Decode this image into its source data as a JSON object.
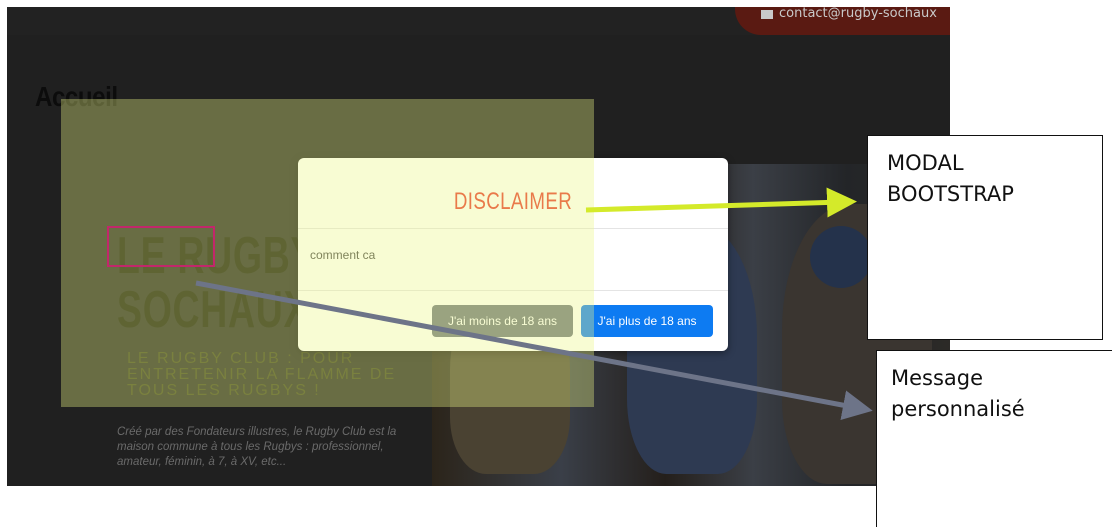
{
  "header": {
    "contact_email": "contact@rugby-sochaux"
  },
  "page": {
    "title": "Accueil"
  },
  "hero": {
    "title_line1": "LE RUGBY",
    "title_line2": "SOCHAUX",
    "subtitle": "LE RUGBY CLUB : POUR ENTRETENIR LA FLAMME DE TOUS LES RUGBYS !",
    "text": "Créé par des Fondateurs illustres, le Rugby Club est la maison commune à tous les Rugbys : professionnel, amateur, féminin, à 7, à XV, etc..."
  },
  "modal": {
    "title": "DISCLAIMER",
    "body": "comment ca",
    "button_minor": "J'ai moins de 18 ans",
    "button_major": "J'ai plus de 18 ans"
  },
  "annotations": {
    "callout_modal_line1": "MODAL",
    "callout_modal_line2": "BOOTSTRAP",
    "callout_message_line1": "Message",
    "callout_message_line2": "personnalisé"
  },
  "colors": {
    "modal_title": "#e8352a",
    "button_major": "#0d7bf2",
    "button_minor": "#6c757d",
    "highlight": "#ecf884",
    "pink_box": "#c2276b",
    "arrow_green": "#d4ea2a",
    "arrow_grey": "#6d7488"
  },
  "icons": {
    "contact": "mail-icon"
  }
}
